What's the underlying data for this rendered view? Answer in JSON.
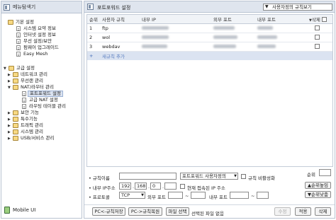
{
  "sidebar": {
    "title": "메뉴탐색기",
    "tree": [
      {
        "label": "기본 설정",
        "type": "folder",
        "level": 0,
        "toggle": "",
        "open": true
      },
      {
        "label": "시스템 요약 정보",
        "type": "doc",
        "level": 1
      },
      {
        "label": "인터넷 설정 정보",
        "type": "doc",
        "level": 1
      },
      {
        "label": "무선 설정/보안",
        "type": "doc",
        "level": 1
      },
      {
        "label": "펌웨어 업그레이드",
        "type": "doc",
        "level": 1
      },
      {
        "label": "Easy Mesh",
        "type": "doc",
        "level": 1
      }
    ],
    "tree2": [
      {
        "label": "고급 설정",
        "type": "folder",
        "level": 0,
        "toggle": "▼"
      },
      {
        "label": "네트워크 관리",
        "type": "folder",
        "level": 1,
        "toggle": "▶"
      },
      {
        "label": "무선랜 관리",
        "type": "folder",
        "level": 1,
        "toggle": "▶"
      },
      {
        "label": "NAT/라우터 관리",
        "type": "folder",
        "level": 1,
        "toggle": "▼"
      },
      {
        "label": "포트포워드 설정",
        "type": "doc",
        "level": 2,
        "selected": true
      },
      {
        "label": "고급 NAT 설정",
        "type": "doc",
        "level": 2
      },
      {
        "label": "라우팅 테이블 관리",
        "type": "doc",
        "level": 2
      },
      {
        "label": "보안 기능",
        "type": "folder",
        "level": 1,
        "toggle": "▶"
      },
      {
        "label": "특수기능",
        "type": "folder",
        "level": 1,
        "toggle": "▶"
      },
      {
        "label": "트래픽 관리",
        "type": "folder",
        "level": 1,
        "toggle": "▶"
      },
      {
        "label": "시스템 관리",
        "type": "folder",
        "level": 1,
        "toggle": "▶"
      },
      {
        "label": "USB/서비스 관리",
        "type": "folder",
        "level": 1,
        "toggle": "▶"
      }
    ],
    "mobile_label": "Mobile UI"
  },
  "main": {
    "title": "포트포워드 설정",
    "view_select": "사용자정의 규칙보기",
    "columns": {
      "num": "순위",
      "name": "사용자 규칙",
      "internal_ip": "내부 IP",
      "external_port": "외부 포트",
      "internal_port": "내부 포트",
      "delete": "삭제"
    },
    "rows": [
      {
        "num": "1",
        "name": "ftp"
      },
      {
        "num": "2",
        "name": "wol"
      },
      {
        "num": "3",
        "name": "webdav"
      }
    ],
    "add_row": {
      "symbol": "+",
      "label": "새규칙 추가"
    }
  },
  "form": {
    "rule_name_label": "• 규칙이름",
    "preset_select": "포트포워드 사용자정의",
    "disable_rule_label": "규칙 비활성화",
    "rank_label": "순위",
    "internal_ip_label": "• 내부 IP주소",
    "ip1": "192",
    "ip2": "168",
    "ip3": "0",
    "ip4": "",
    "current_ip_label": "현재 접속된 IP 주소",
    "rank_up_label": "▲순위높임",
    "protocol_label": "• 프로토콜",
    "protocol_value": "TCP",
    "external_port_label": "외부 포트",
    "internal_port_label": "내부 포트",
    "tilde": "~",
    "rank_down_label": "▼순위낮춤"
  },
  "buttons": {
    "pc_save": "PC<-규칙저장",
    "pc_restore": "PC->규칙복원",
    "file_select": "파일 선택",
    "no_file": "선택된 파일 없음",
    "modify": "수정",
    "apply": "적용",
    "delete": "삭제"
  }
}
